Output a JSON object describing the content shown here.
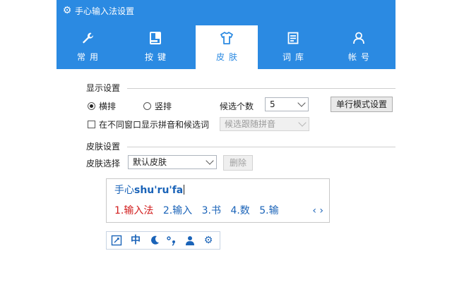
{
  "window": {
    "title": "手心输入法设置"
  },
  "tabs": [
    {
      "label": "常用",
      "icon": "wrench-icon",
      "active": false
    },
    {
      "label": "按键",
      "icon": "keyboard-icon",
      "active": false
    },
    {
      "label": "皮肤",
      "icon": "shirt-icon",
      "active": true
    },
    {
      "label": "词库",
      "icon": "book-icon",
      "active": false
    },
    {
      "label": "帐号",
      "icon": "user-icon",
      "active": false
    }
  ],
  "display_settings": {
    "title": "显示设置",
    "horizontal_label": "横排",
    "vertical_label": "竖排",
    "orientation_selected": "横排",
    "candidate_count_label": "候选个数",
    "candidate_count_value": "5",
    "single_mode_button": "单行模式设置",
    "diff_window_label": "在不同窗口显示拼音和候选词",
    "diff_window_checked": false,
    "follow_select_value": "候选跟随拼音"
  },
  "skin_settings": {
    "title": "皮肤设置",
    "skin_select_label": "皮肤选择",
    "skin_value": "默认皮肤",
    "delete_button": "删除"
  },
  "preview": {
    "composition_prefix": "手心",
    "composition_pinyin": "shu'ru'fa",
    "candidates": [
      "1.输入法",
      "2.输入",
      "3.书",
      "4.数",
      "5.输"
    ],
    "nav_prev": "‹",
    "nav_next": "›"
  },
  "statusbar": {
    "icons": [
      "edit-icon",
      "chinese-mode-icon",
      "moon-icon",
      "punctuation-icon",
      "user-icon",
      "gear-icon"
    ],
    "mode_label": "中"
  },
  "colors": {
    "accent": "#2b8ae2",
    "candidate_highlight": "#d21d1d",
    "candidate_text": "#1a63b8"
  }
}
